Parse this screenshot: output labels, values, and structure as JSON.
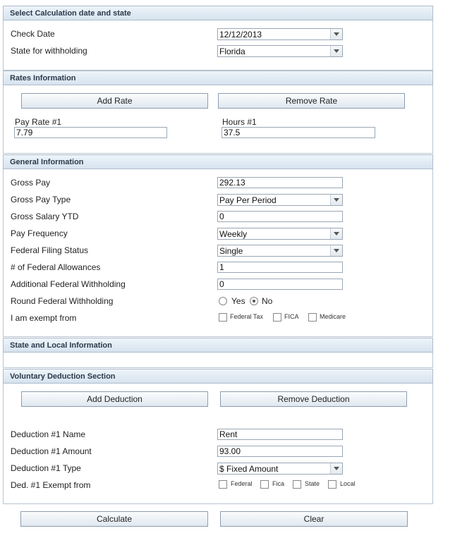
{
  "calc": {
    "header": "Select Calculation date and state",
    "check_date_label": "Check Date",
    "check_date_value": "12/12/2013",
    "state_label": "State for withholding",
    "state_value": "Florida"
  },
  "rates": {
    "header": "Rates Information",
    "add_button": "Add Rate",
    "remove_button": "Remove Rate",
    "pay_rate_label": "Pay Rate #1",
    "pay_rate_value": "7.79",
    "hours_label": "Hours #1",
    "hours_value": "37.5"
  },
  "general": {
    "header": "General Information",
    "gross_pay_label": "Gross Pay",
    "gross_pay_value": "292.13",
    "gross_pay_type_label": "Gross Pay Type",
    "gross_pay_type_value": "Pay Per Period",
    "gross_salary_ytd_label": "Gross Salary YTD",
    "gross_salary_ytd_value": "0",
    "pay_frequency_label": "Pay Frequency",
    "pay_frequency_value": "Weekly",
    "filing_status_label": "Federal Filing Status",
    "filing_status_value": "Single",
    "allowances_label": "# of Federal Allowances",
    "allowances_value": "1",
    "additional_withholding_label": "Additional Federal Withholding",
    "additional_withholding_value": "0",
    "round_label": "Round Federal Withholding",
    "round_yes": "Yes",
    "round_no": "No",
    "exempt_label": "I am exempt from",
    "exempt_federal": "Federal Tax",
    "exempt_fica": "FICA",
    "exempt_medicare": "Medicare"
  },
  "state_local": {
    "header": "State and Local Information"
  },
  "deduction": {
    "header": "Voluntary Deduction Section",
    "add_button": "Add Deduction",
    "remove_button": "Remove Deduction",
    "name_label": "Deduction #1 Name",
    "name_value": "Rent",
    "amount_label": "Deduction #1 Amount",
    "amount_value": "93.00",
    "type_label": "Deduction #1 Type",
    "type_value": "$ Fixed Amount",
    "exempt_label": "Ded. #1 Exempt from",
    "exempt_federal": "Federal",
    "exempt_fica": "Fica",
    "exempt_state": "State",
    "exempt_local": "Local"
  },
  "actions": {
    "calculate": "Calculate",
    "clear": "Clear"
  }
}
